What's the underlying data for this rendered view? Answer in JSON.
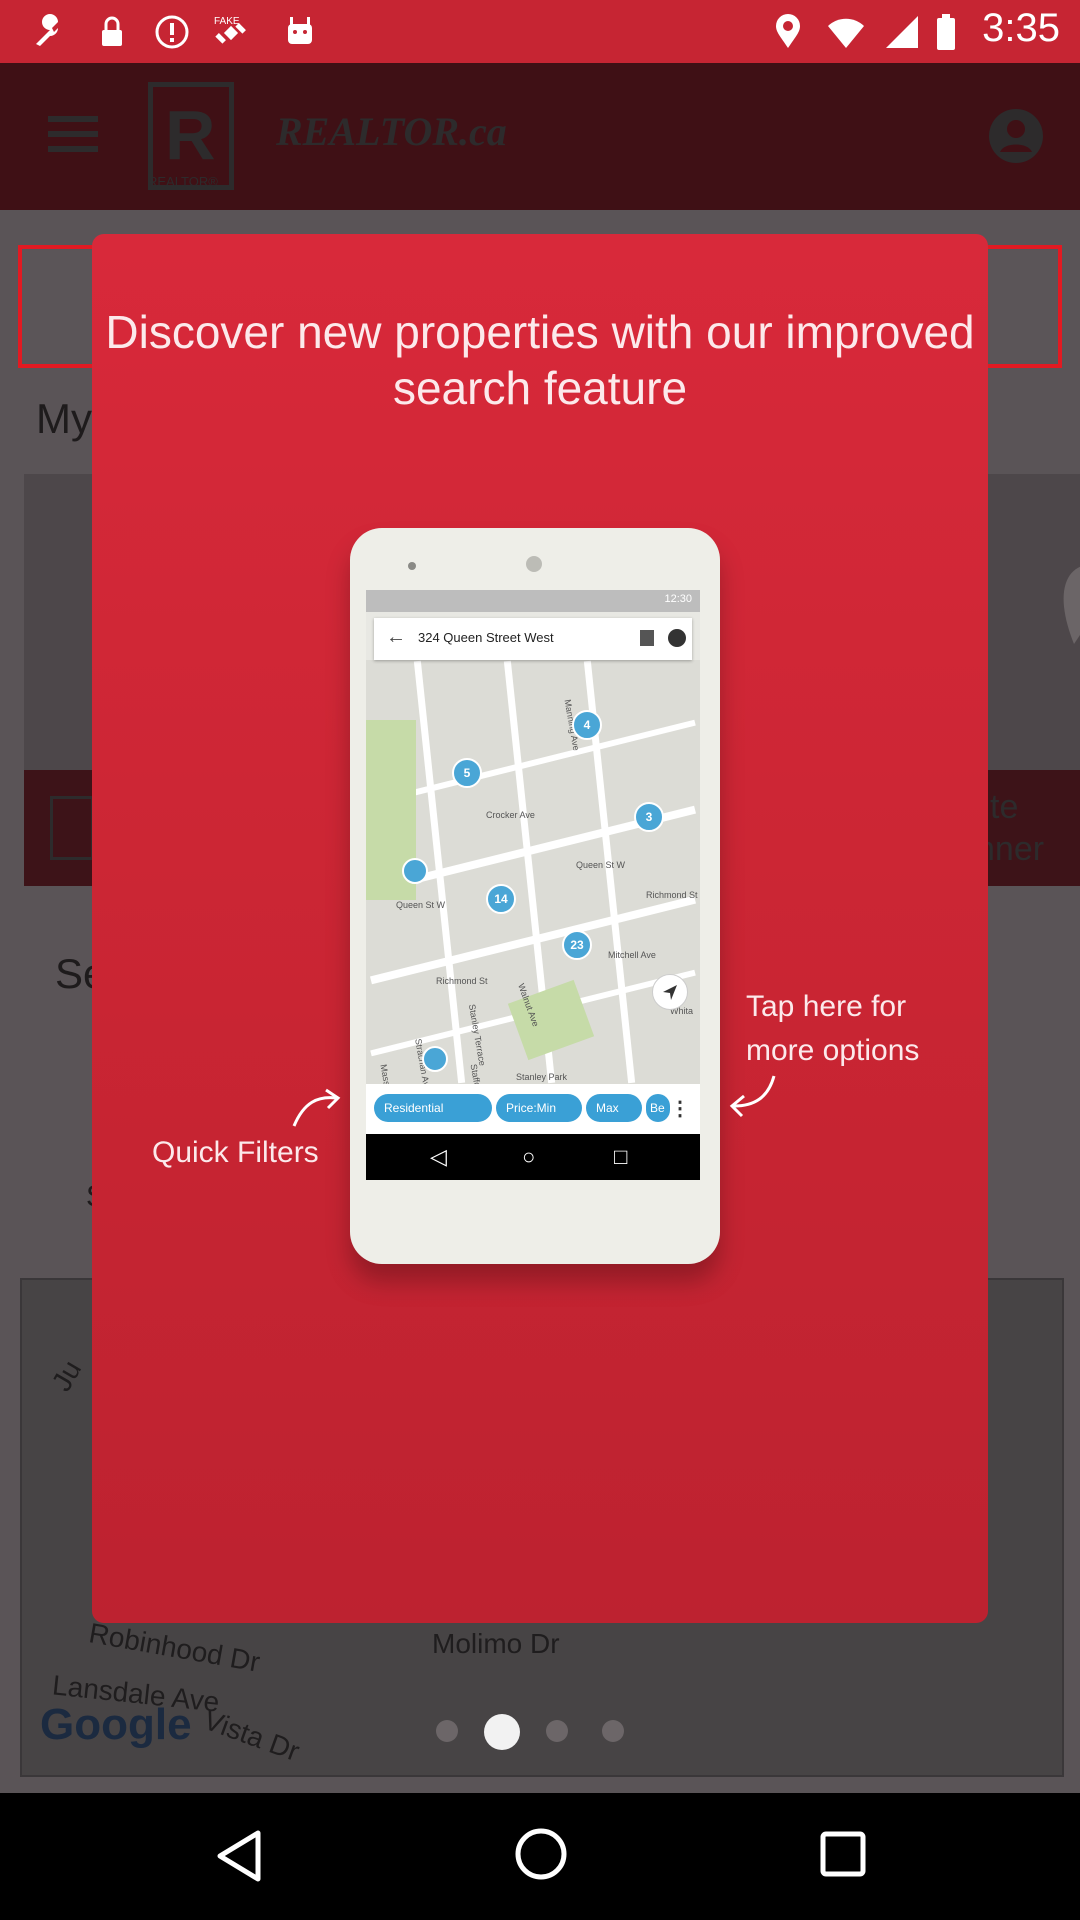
{
  "status_bar": {
    "time": "3:35",
    "icons": [
      "wrench-icon",
      "lock-icon",
      "alert-icon",
      "fake-gps-icon",
      "android-icon",
      "location-icon",
      "wifi-icon",
      "signal-icon",
      "battery-icon"
    ]
  },
  "app": {
    "title": "REALTOR.ca",
    "logo_letter": "R",
    "logo_subtitle": "REALTOR®",
    "my_label": "My",
    "se_label": "Se",
    "s_label": "S",
    "banner_line1": "te",
    "banner_line2": "nner",
    "map_streets": [
      "Ju",
      "Robinhood Dr",
      "Molimo Dr",
      "Lansdale Ave",
      "Vista Dr"
    ],
    "map_brand": "Google"
  },
  "modal": {
    "title": "Discover new properties with our improved search feature",
    "quick_filters_label": "Quick Filters",
    "tap_here_line1": "Tap here for",
    "tap_here_line2": "more options"
  },
  "phone_screen": {
    "status_time": "12:30",
    "search_text": "324 Queen Street West",
    "pins": [
      "4",
      "5",
      "3",
      "14",
      "23"
    ],
    "streets": [
      "Crocker Ave",
      "Queen St W",
      "Queen St W",
      "Richmond St",
      "Mitchell Ave",
      "Walnut Ave",
      "Stanley Terrace",
      "Strachan Ave",
      "Stafford St",
      "Massey St",
      "Stanley Park",
      "Manning Ave",
      "Richmond St",
      "Whita"
    ],
    "filters": [
      "Residential",
      "Price:Min",
      "Max",
      "Be"
    ]
  },
  "pager": {
    "count": 4,
    "active_index": 1
  },
  "colors": {
    "brand_red": "#d8293a",
    "highlight": "#e21a22",
    "pin_blue": "#4aa6d6"
  }
}
